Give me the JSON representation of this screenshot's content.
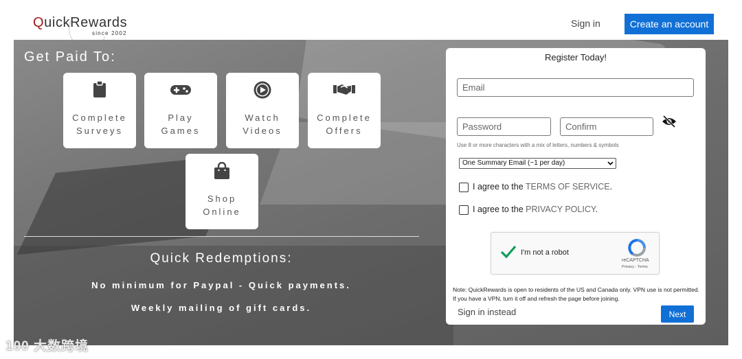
{
  "header": {
    "logo_main": "QuickRewards",
    "logo_since": "since 2002",
    "sign_in": "Sign in",
    "create_account": "Create an account"
  },
  "hero": {
    "title": "Get Paid To:",
    "tiles": [
      {
        "line1": "Complete",
        "line2": "Surveys",
        "icon": "clipboard-icon"
      },
      {
        "line1": "Play",
        "line2": "Games",
        "icon": "gamepad-icon"
      },
      {
        "line1": "Watch",
        "line2": "Videos",
        "icon": "play-circle-icon"
      },
      {
        "line1": "Complete",
        "line2": "Offers",
        "icon": "handshake-icon"
      },
      {
        "line1": "Shop",
        "line2": "Online",
        "icon": "shopping-bag-icon"
      }
    ],
    "redemptions_title": "Quick Redemptions:",
    "redemptions_line1": "No minimum for Paypal - Quick payments.",
    "redemptions_line2": "Weekly mailing of gift cards."
  },
  "register": {
    "title": "Register Today!",
    "email_placeholder": "Email",
    "password_placeholder": "Password",
    "confirm_placeholder": "Confirm",
    "password_hint": "Use 8 or more characters with a mix of letters, numbers & symbols",
    "email_frequency": "One Summary Email (~1 per day)",
    "terms_prefix": "I agree to the ",
    "terms_link": "TERMS OF SERVICE",
    "privacy_prefix": "I agree to the ",
    "privacy_link": "PRIVACY POLICY",
    "period": ".",
    "captcha_label": "I'm not a robot",
    "captcha_brand": "reCAPTCHA",
    "captcha_sub": "Privacy - Terms",
    "note": "Note: QuickRewards is open to residents of the US and Canada only. VPN use is not permitted. If you have a VPN, turn it off and refresh the page before joining.",
    "sign_instead": "Sign in instead",
    "next": "Next"
  },
  "watermark": "100 大数跨境",
  "colors": {
    "accent": "#1170d6",
    "logo_q": "#a01c1c",
    "check_green": "#0f9d58"
  }
}
